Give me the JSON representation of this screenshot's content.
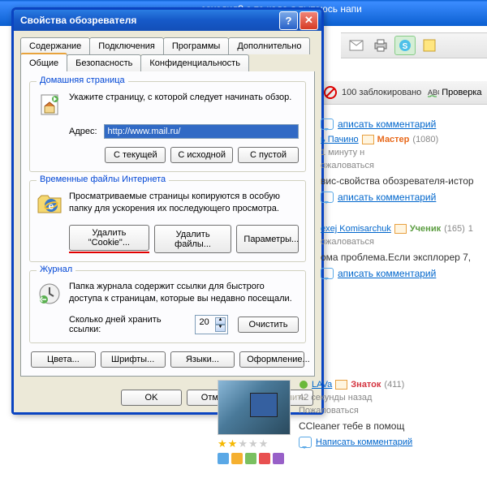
{
  "bg_title": "заходил? а то када я пытаюсь напи",
  "dialog": {
    "title": "Свойства обозревателя",
    "tabs": {
      "content": "Содержание",
      "connections": "Подключения",
      "programs": "Программы",
      "advanced": "Дополнительно",
      "general": "Общие",
      "security": "Безопасность",
      "privacy": "Конфиденциальность"
    },
    "home": {
      "group": "Домашняя страница",
      "desc": "Укажите страницу, с которой следует начинать обзор.",
      "addr_label": "Адрес:",
      "addr_value": "http://www.mail.ru/",
      "btn_current": "С текущей",
      "btn_default": "С исходной",
      "btn_blank": "С пустой"
    },
    "temp": {
      "group": "Временные файлы Интернета",
      "desc": "Просматриваемые страницы копируются в особую папку для ускорения их последующего просмотра.",
      "btn_cookie": "Удалить \"Cookie\"...",
      "btn_files": "Удалить файлы...",
      "btn_params": "Параметры..."
    },
    "journal": {
      "group": "Журнал",
      "desc": "Папка журнала содержит ссылки для быстрого доступа к страницам, которые вы недавно посещали.",
      "keep_label": "Сколько дней хранить ссылки:",
      "days": "20",
      "btn_clear": "Очистить"
    },
    "bottom": {
      "colors": "Цвета...",
      "fonts": "Шрифты...",
      "languages": "Языки...",
      "accessibility": "Оформление..."
    },
    "footer": {
      "ok": "OK",
      "cancel": "Отмена",
      "apply": "Применить"
    }
  },
  "toolbar2": {
    "blocked_count": "100 заблокировано",
    "check": "Проверка"
  },
  "answers": {
    "comment_label": "аписать комментарий",
    "a1": {
      "user": "ь Пачино",
      "rank": "Мастер",
      "score": "(1080)",
      "time": "1 минуту н",
      "complain": "ожаловаться",
      "text": "вис-свойства обозревателя-истор"
    },
    "a2": {
      "user": "exej Komisarchuk",
      "rank": "Ученик",
      "score": "(165)",
      "time": "1",
      "complain": "ожаловаться",
      "text": "ома проблема.Если эксплорер 7,"
    },
    "a3": {
      "user": "LAVa",
      "rank": "Знаток",
      "score": "(411)",
      "time": "42 секунды назад",
      "complain": "Пожаловаться",
      "text": "CCleaner тебе в помощ",
      "comment": "Написать комментарий"
    }
  }
}
